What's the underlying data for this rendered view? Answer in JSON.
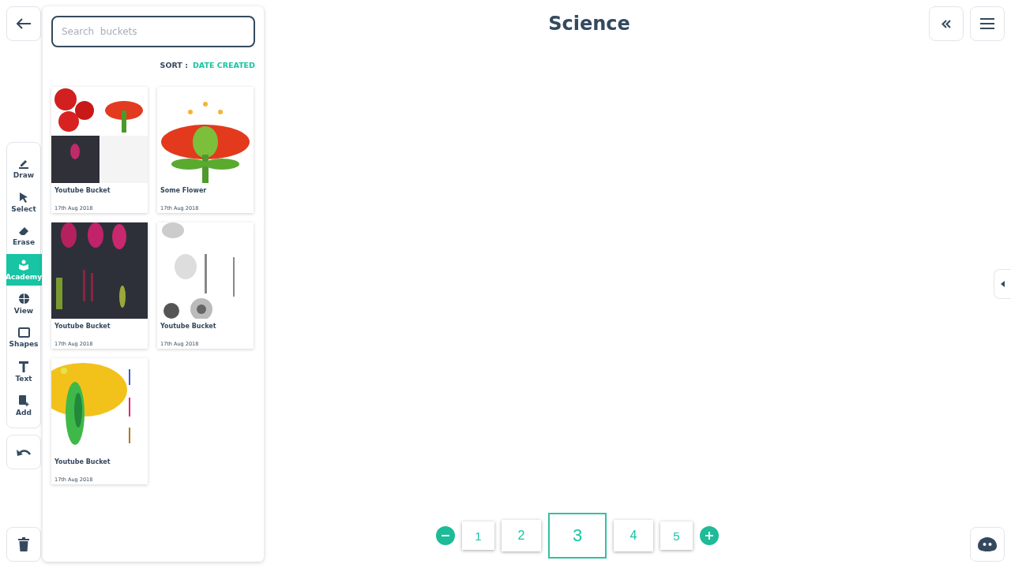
{
  "title": "Science",
  "search": {
    "placeholder": "Search  buckets"
  },
  "sort": {
    "label": "SORT :",
    "value": "DATE CREATED"
  },
  "buckets": [
    {
      "kind": "picture",
      "name": "Youtube Bucket",
      "date": "17th Aug 2018"
    },
    {
      "kind": "picture",
      "name": "Some Flower",
      "date": "17th Aug 2018"
    },
    {
      "kind": "picture",
      "name": "Youtube Bucket",
      "date": "17th Aug 2018"
    },
    {
      "kind": "picture",
      "name": "Youtube Bucket",
      "date": "17th Aug 2018"
    },
    {
      "kind": "picture",
      "name": "Youtube Bucket",
      "date": "17th Aug 2018"
    }
  ],
  "tools": [
    {
      "kind": "draw",
      "label": "Draw",
      "selected": false
    },
    {
      "kind": "select",
      "label": "Select",
      "selected": false
    },
    {
      "kind": "erase",
      "label": "Erase",
      "selected": false
    },
    {
      "kind": "academy",
      "label": "Academy",
      "selected": true
    },
    {
      "kind": "view",
      "label": "View",
      "selected": false
    },
    {
      "kind": "shapes",
      "label": "Shapes",
      "selected": false
    },
    {
      "kind": "text",
      "label": "Text",
      "selected": false
    },
    {
      "kind": "add",
      "label": "Add",
      "selected": false
    }
  ],
  "pages": [
    {
      "label": "1",
      "selected": false
    },
    {
      "label": "2",
      "selected": false
    },
    {
      "label": "3",
      "selected": true
    },
    {
      "label": "4",
      "selected": false
    },
    {
      "label": "5",
      "selected": false
    }
  ]
}
